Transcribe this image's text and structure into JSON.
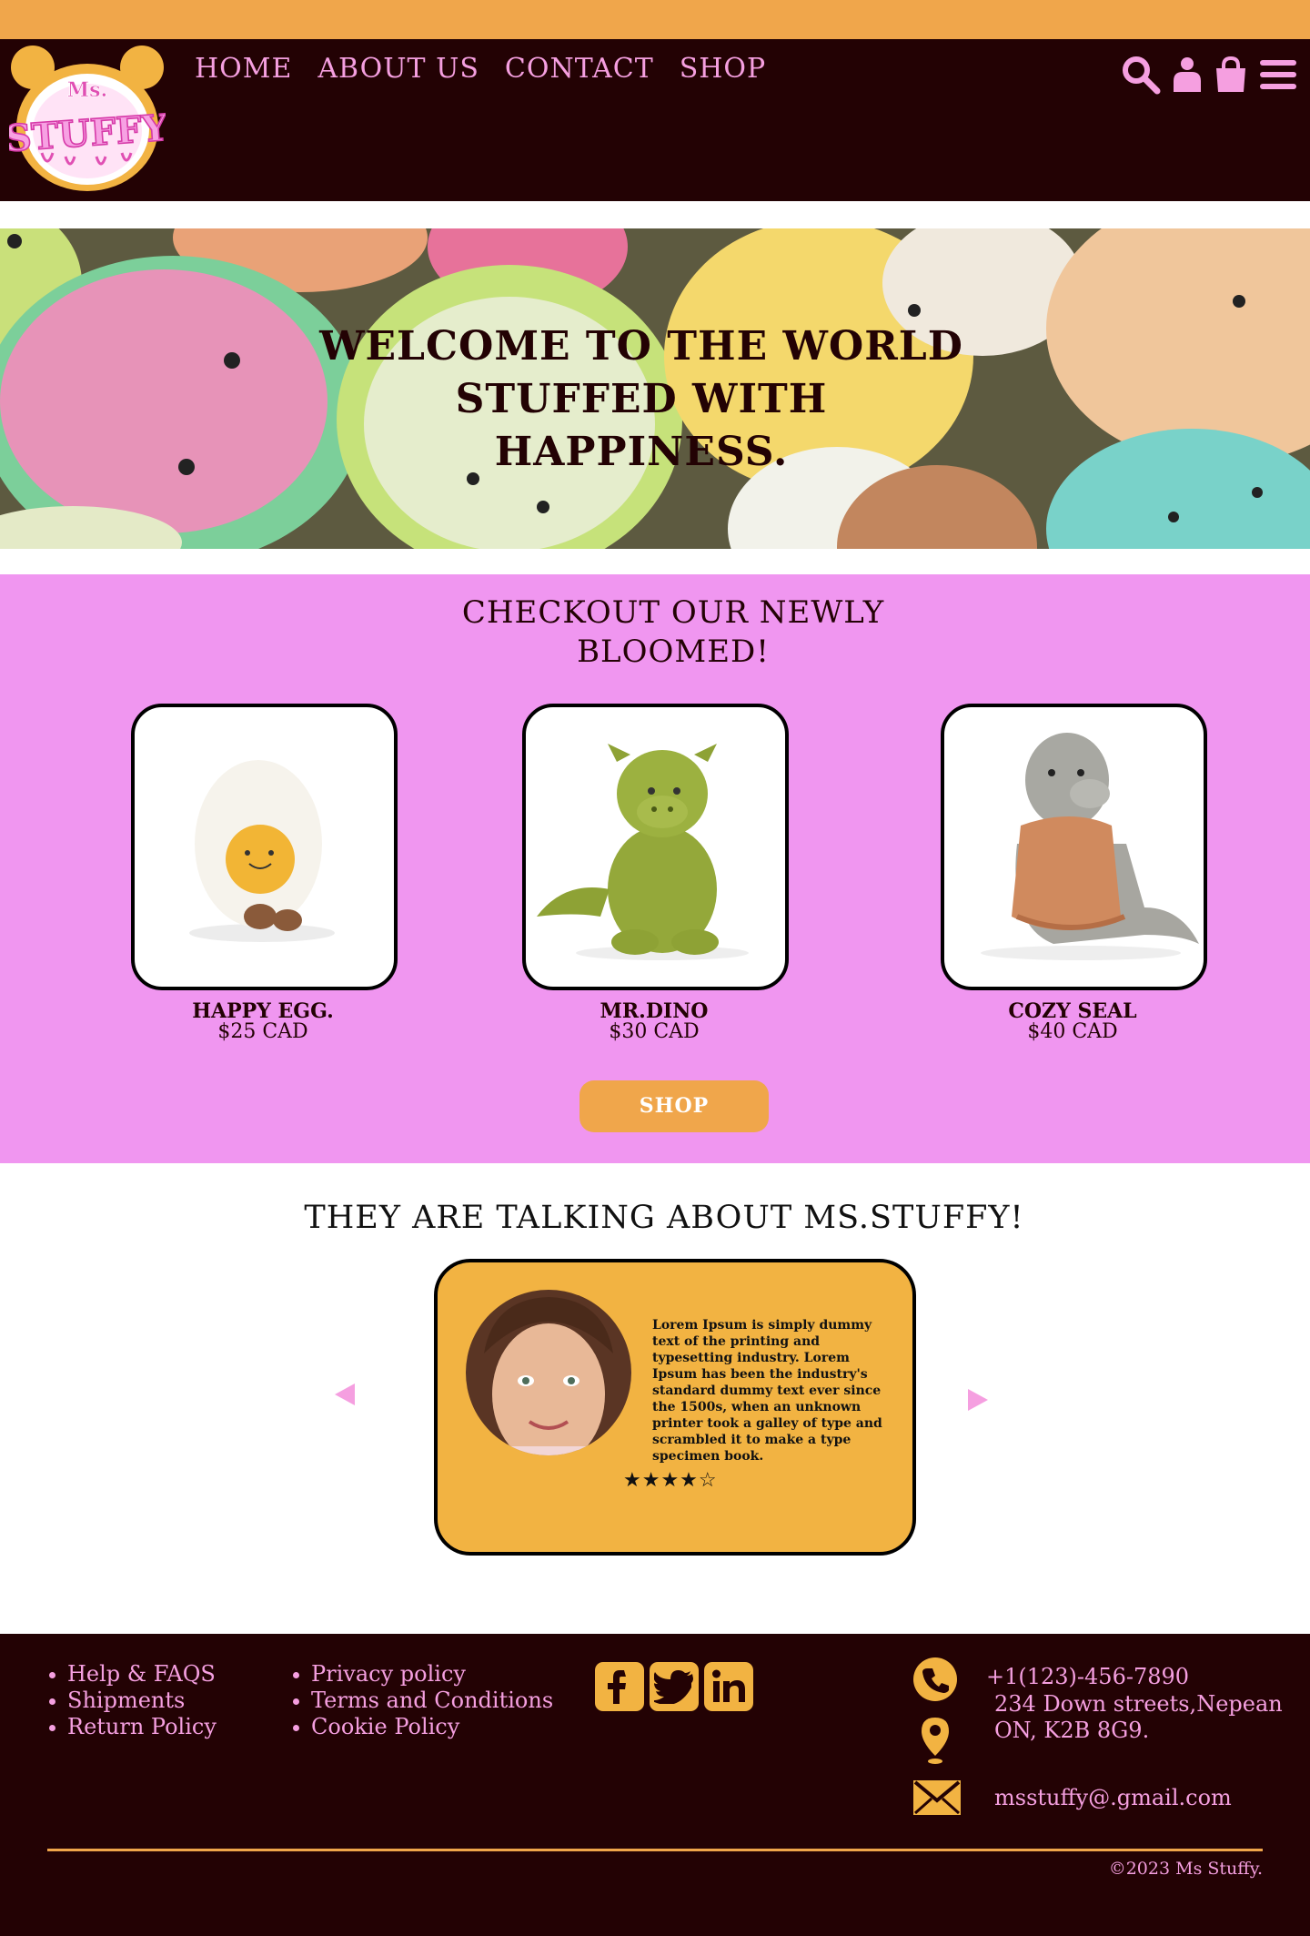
{
  "brand": {
    "logo_text": "Ms. Stuffy",
    "accent": "#f0a64b",
    "pink": "#f59fe0",
    "dark": "#230204",
    "section_pink": "#f096f0"
  },
  "nav": {
    "links": [
      "HOME",
      "ABOUT US",
      "CONTACT",
      "SHOP"
    ],
    "icons": [
      "search-icon",
      "user-icon",
      "shopping-bag-icon",
      "menu-icon"
    ]
  },
  "hero": {
    "title": "WELCOME TO THE WORLD STUFFED WITH HAPPINESS."
  },
  "new_arrivals": {
    "title": "CHECKOUT OUR NEWLY BLOOMED!",
    "products": [
      {
        "name": "HAPPY EGG.",
        "price": "$25 CAD"
      },
      {
        "name": "MR.DINO",
        "price": "$30 CAD"
      },
      {
        "name": "COZY SEAL",
        "price": "$40 CAD"
      }
    ],
    "shop_label": "SHOP"
  },
  "testimonials": {
    "title": "THEY ARE TALKING ABOUT MS.STUFFY!",
    "review": "Lorem Ipsum is simply dummy text of the printing and typesetting industry. Lorem Ipsum has been the industry's standard dummy text ever since the 1500s, when an unknown printer took a galley of type and scrambled it to make a type specimen book.",
    "stars": "★★★★☆",
    "rating": 4,
    "rating_max": 5
  },
  "footer": {
    "links_col1": [
      "Help & FAQS",
      "Shipments",
      "Return Policy"
    ],
    "links_col2": [
      "Privacy policy",
      "Terms and Conditions",
      "Cookie Policy"
    ],
    "social": [
      "facebook-icon",
      "twitter-icon",
      "linkedin-icon"
    ],
    "phone": "+1(123)-456-7890",
    "address_line1": "234 Down streets,Nepean",
    "address_line2": "ON, K2B 8G9.",
    "email": "msstuffy@.gmail.com",
    "copyright": "©2023 Ms Stuffy."
  }
}
